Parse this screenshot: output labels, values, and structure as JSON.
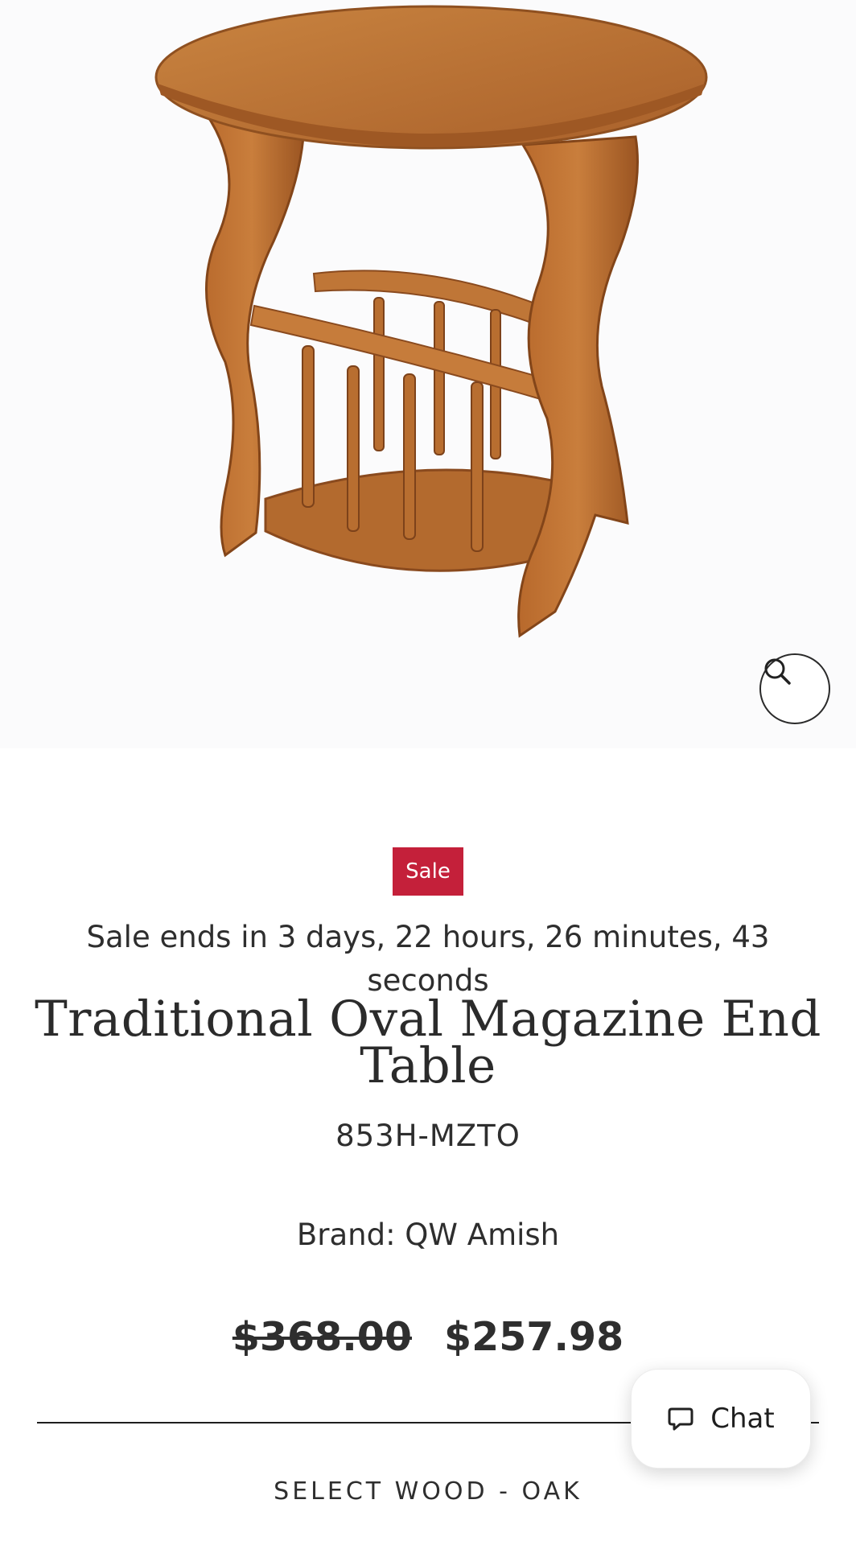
{
  "product": {
    "badge": "Sale",
    "sale_timer": "Sale ends in 3 days, 22 hours, 26 minutes, 43 seconds",
    "title": "Traditional Oval Magazine End Table",
    "sku": "853H-MZTO",
    "brand": "Brand: QW Amish",
    "price_original": "$368.00",
    "price_sale": "$257.98"
  },
  "chat": {
    "label": "Chat",
    "icon": "chat-bubble-icon"
  },
  "zoom": {
    "icon": "search-icon"
  },
  "options": {
    "wood_label": "SELECT WOOD - OAK"
  },
  "colors": {
    "sale_badge": "#c4203a",
    "wood": "#b5692a"
  }
}
